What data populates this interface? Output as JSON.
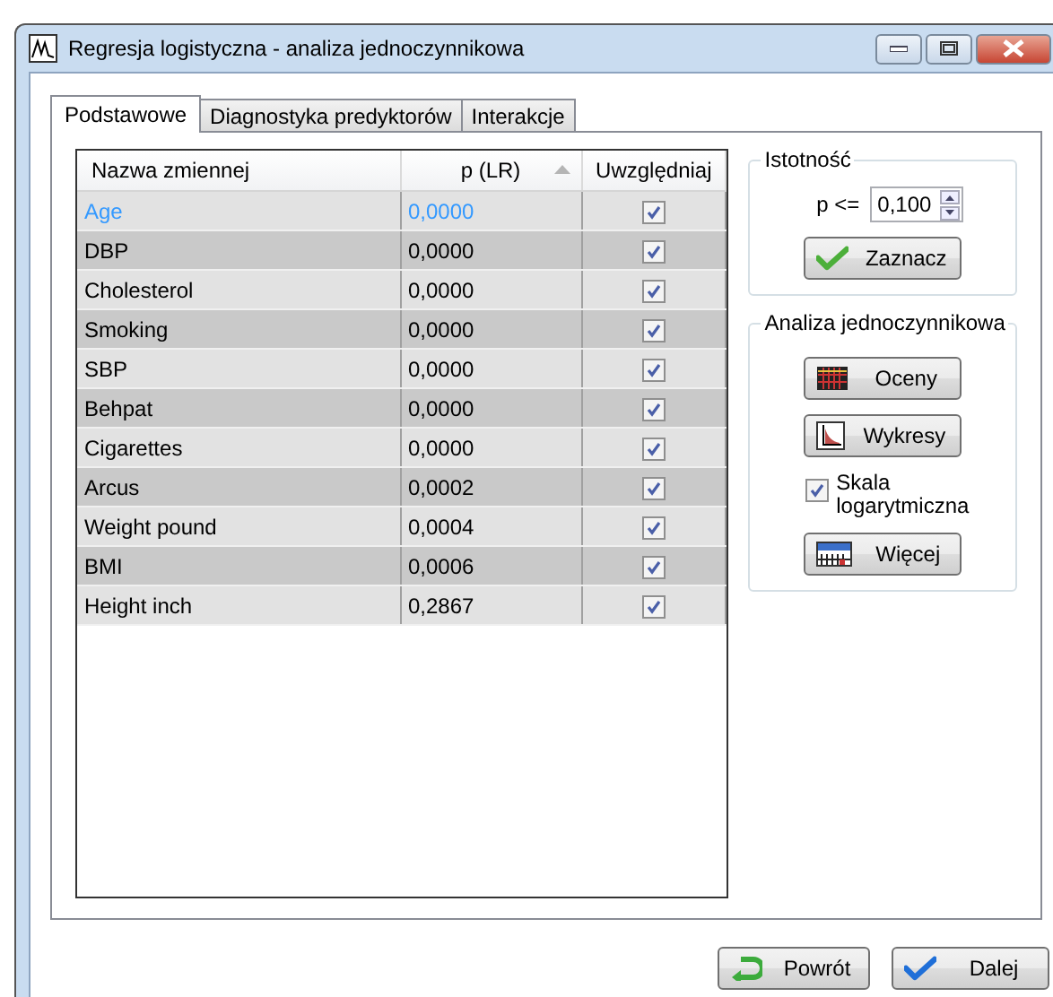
{
  "window": {
    "title": "Regresja logistyczna - analiza jednoczynnikowa"
  },
  "tabs": [
    {
      "label": "Podstawowe",
      "selected": true
    },
    {
      "label": "Diagnostyka predyktorów",
      "selected": false
    },
    {
      "label": "Interakcje",
      "selected": false
    }
  ],
  "table": {
    "columns": [
      {
        "label": "Nazwa zmiennej",
        "sorted": false
      },
      {
        "label": "p (LR)",
        "sorted": true
      },
      {
        "label": "Uwzględniaj",
        "sorted": false
      }
    ],
    "rows": [
      {
        "name": "Age",
        "p": "0,0000",
        "included": true,
        "selected": true
      },
      {
        "name": "DBP",
        "p": "0,0000",
        "included": true,
        "selected": false
      },
      {
        "name": "Cholesterol",
        "p": "0,0000",
        "included": true,
        "selected": false
      },
      {
        "name": "Smoking",
        "p": "0,0000",
        "included": true,
        "selected": false
      },
      {
        "name": "SBP",
        "p": "0,0000",
        "included": true,
        "selected": false
      },
      {
        "name": "Behpat",
        "p": "0,0000",
        "included": true,
        "selected": false
      },
      {
        "name": "Cigarettes",
        "p": "0,0000",
        "included": true,
        "selected": false
      },
      {
        "name": "Arcus",
        "p": "0,0002",
        "included": true,
        "selected": false
      },
      {
        "name": "Weight pound",
        "p": "0,0004",
        "included": true,
        "selected": false
      },
      {
        "name": "BMI",
        "p": "0,0006",
        "included": true,
        "selected": false
      },
      {
        "name": "Height inch",
        "p": "0,2867",
        "included": true,
        "selected": false
      }
    ]
  },
  "significance": {
    "title": "Istotność",
    "label": "p <=",
    "value": "0,100",
    "button": "Zaznacz"
  },
  "univariate": {
    "title": "Analiza jednoczynnikowa",
    "buttons": [
      {
        "label": "Oceny",
        "kind": "grid"
      },
      {
        "label": "Wykresy",
        "kind": "chart"
      }
    ],
    "log_scale": {
      "label": "Skala logarytmiczna",
      "checked": true
    },
    "more_button": "Więcej"
  },
  "footer_buttons": [
    {
      "label": "Powrót",
      "kind": "back"
    },
    {
      "label": "Dalej",
      "kind": "next"
    }
  ]
}
